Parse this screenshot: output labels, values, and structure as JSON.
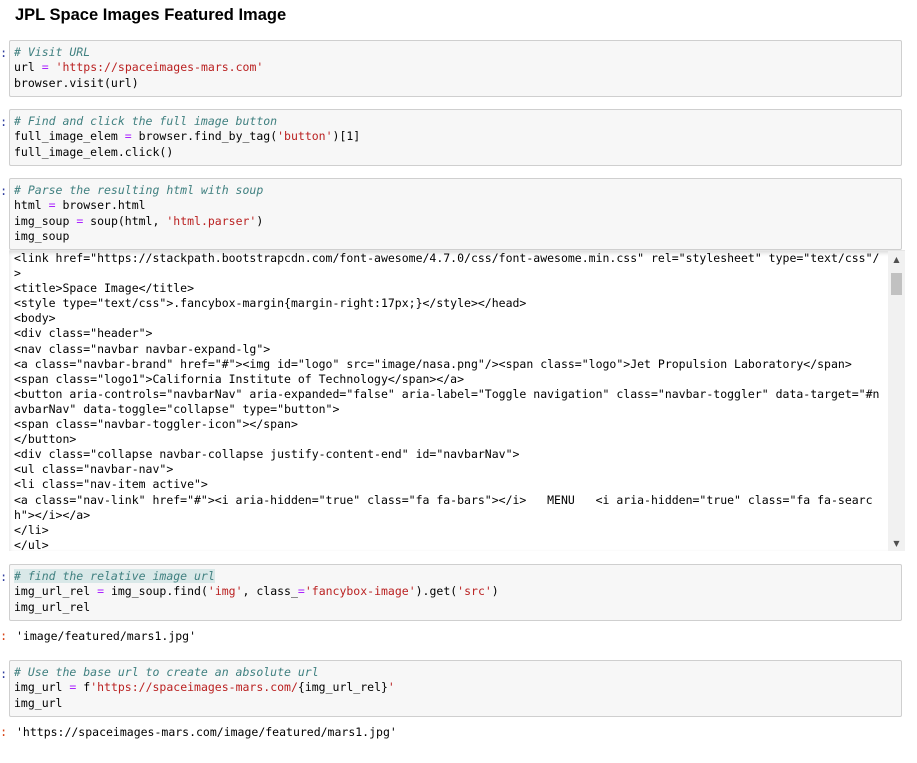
{
  "heading": "JPL Space Images Featured Image",
  "prompt_marker": ":",
  "cells": [
    {
      "lines": [
        [
          {
            "t": "# Visit URL",
            "c": "cm-comment"
          }
        ],
        [
          {
            "t": "url "
          },
          {
            "t": "=",
            "c": "cm-op"
          },
          {
            "t": " "
          },
          {
            "t": "'https://spaceimages-mars.com'",
            "c": "cm-string"
          }
        ],
        [
          {
            "t": "browser.visit(url)"
          }
        ]
      ]
    },
    {
      "lines": [
        [
          {
            "t": "# Find and click the full image button",
            "c": "cm-comment"
          }
        ],
        [
          {
            "t": "full_image_elem "
          },
          {
            "t": "=",
            "c": "cm-op"
          },
          {
            "t": " browser.find_by_tag("
          },
          {
            "t": "'button'",
            "c": "cm-string"
          },
          {
            "t": ")[1]"
          }
        ],
        [
          {
            "t": "full_image_elem.click()"
          }
        ]
      ]
    },
    {
      "lines": [
        [
          {
            "t": "# Parse the resulting html with soup",
            "c": "cm-comment"
          }
        ],
        [
          {
            "t": "html "
          },
          {
            "t": "=",
            "c": "cm-op"
          },
          {
            "t": " browser.html"
          }
        ],
        [
          {
            "t": "img_soup "
          },
          {
            "t": "=",
            "c": "cm-op"
          },
          {
            "t": " soup(html, "
          },
          {
            "t": "'html.parser'",
            "c": "cm-string"
          },
          {
            "t": ")"
          }
        ],
        [
          {
            "t": "img_soup"
          }
        ]
      ]
    },
    {
      "lines": [
        [
          {
            "t": "# find the relative image url",
            "c": "cm-comment hl"
          }
        ],
        [
          {
            "t": "img_url_rel "
          },
          {
            "t": "=",
            "c": "cm-op"
          },
          {
            "t": " img_soup.find("
          },
          {
            "t": "'img'",
            "c": "cm-string"
          },
          {
            "t": ", class_"
          },
          {
            "t": "=",
            "c": "cm-op"
          },
          {
            "t": "'fancybox-image'",
            "c": "cm-string"
          },
          {
            "t": ").get("
          },
          {
            "t": "'src'",
            "c": "cm-string"
          },
          {
            "t": ")"
          }
        ],
        [
          {
            "t": "img_url_rel"
          }
        ]
      ]
    },
    {
      "lines": [
        [
          {
            "t": "# Use the base url to create an absolute url",
            "c": "cm-comment"
          }
        ],
        [
          {
            "t": "img_url "
          },
          {
            "t": "=",
            "c": "cm-op"
          },
          {
            "t": " f"
          },
          {
            "t": "'https://spaceimages-mars.com/",
            "c": "cm-string"
          },
          {
            "t": "{img_url_rel}"
          },
          {
            "t": "'",
            "c": "cm-string"
          }
        ],
        [
          {
            "t": "img_url"
          }
        ]
      ]
    }
  ],
  "soup_output_lines": [
    "<link href=\"https://stackpath.bootstrapcdn.com/font-awesome/4.7.0/css/font-awesome.min.css\" rel=\"stylesheet\" type=\"text/css\"/",
    ">",
    "<title>Space Image</title>",
    "<style type=\"text/css\">.fancybox-margin{margin-right:17px;}</style></head>",
    "<body>",
    "<div class=\"header\">",
    "<nav class=\"navbar navbar-expand-lg\">",
    "<a class=\"navbar-brand\" href=\"#\"><img id=\"logo\" src=\"image/nasa.png\"/><span class=\"logo\">Jet Propulsion Laboratory</span>",
    "<span class=\"logo1\">California Institute of Technology</span></a>",
    "<button aria-controls=\"navbarNav\" aria-expanded=\"false\" aria-label=\"Toggle navigation\" class=\"navbar-toggler\" data-target=\"#n",
    "avbarNav\" data-toggle=\"collapse\" type=\"button\">",
    "<span class=\"navbar-toggler-icon\"></span>",
    "</button>",
    "<div class=\"collapse navbar-collapse justify-content-end\" id=\"navbarNav\">",
    "<ul class=\"navbar-nav\">",
    "<li class=\"nav-item active\">",
    "<a class=\"nav-link\" href=\"#\"><i aria-hidden=\"true\" class=\"fa fa-bars\"></i>   MENU   <i aria-hidden=\"true\" class=\"fa fa-searc",
    "h\"></i></a>",
    "</li>",
    "</ul>"
  ],
  "outputs": {
    "img_url_rel": "'image/featured/mars1.jpg'",
    "img_url": "'https://spaceimages-mars.com/image/featured/mars1.jpg'"
  },
  "scrollbar": {
    "up_icon": "up-arrow-icon",
    "down_icon": "down-arrow-icon",
    "up_glyph": "▲",
    "down_glyph": "▼"
  }
}
